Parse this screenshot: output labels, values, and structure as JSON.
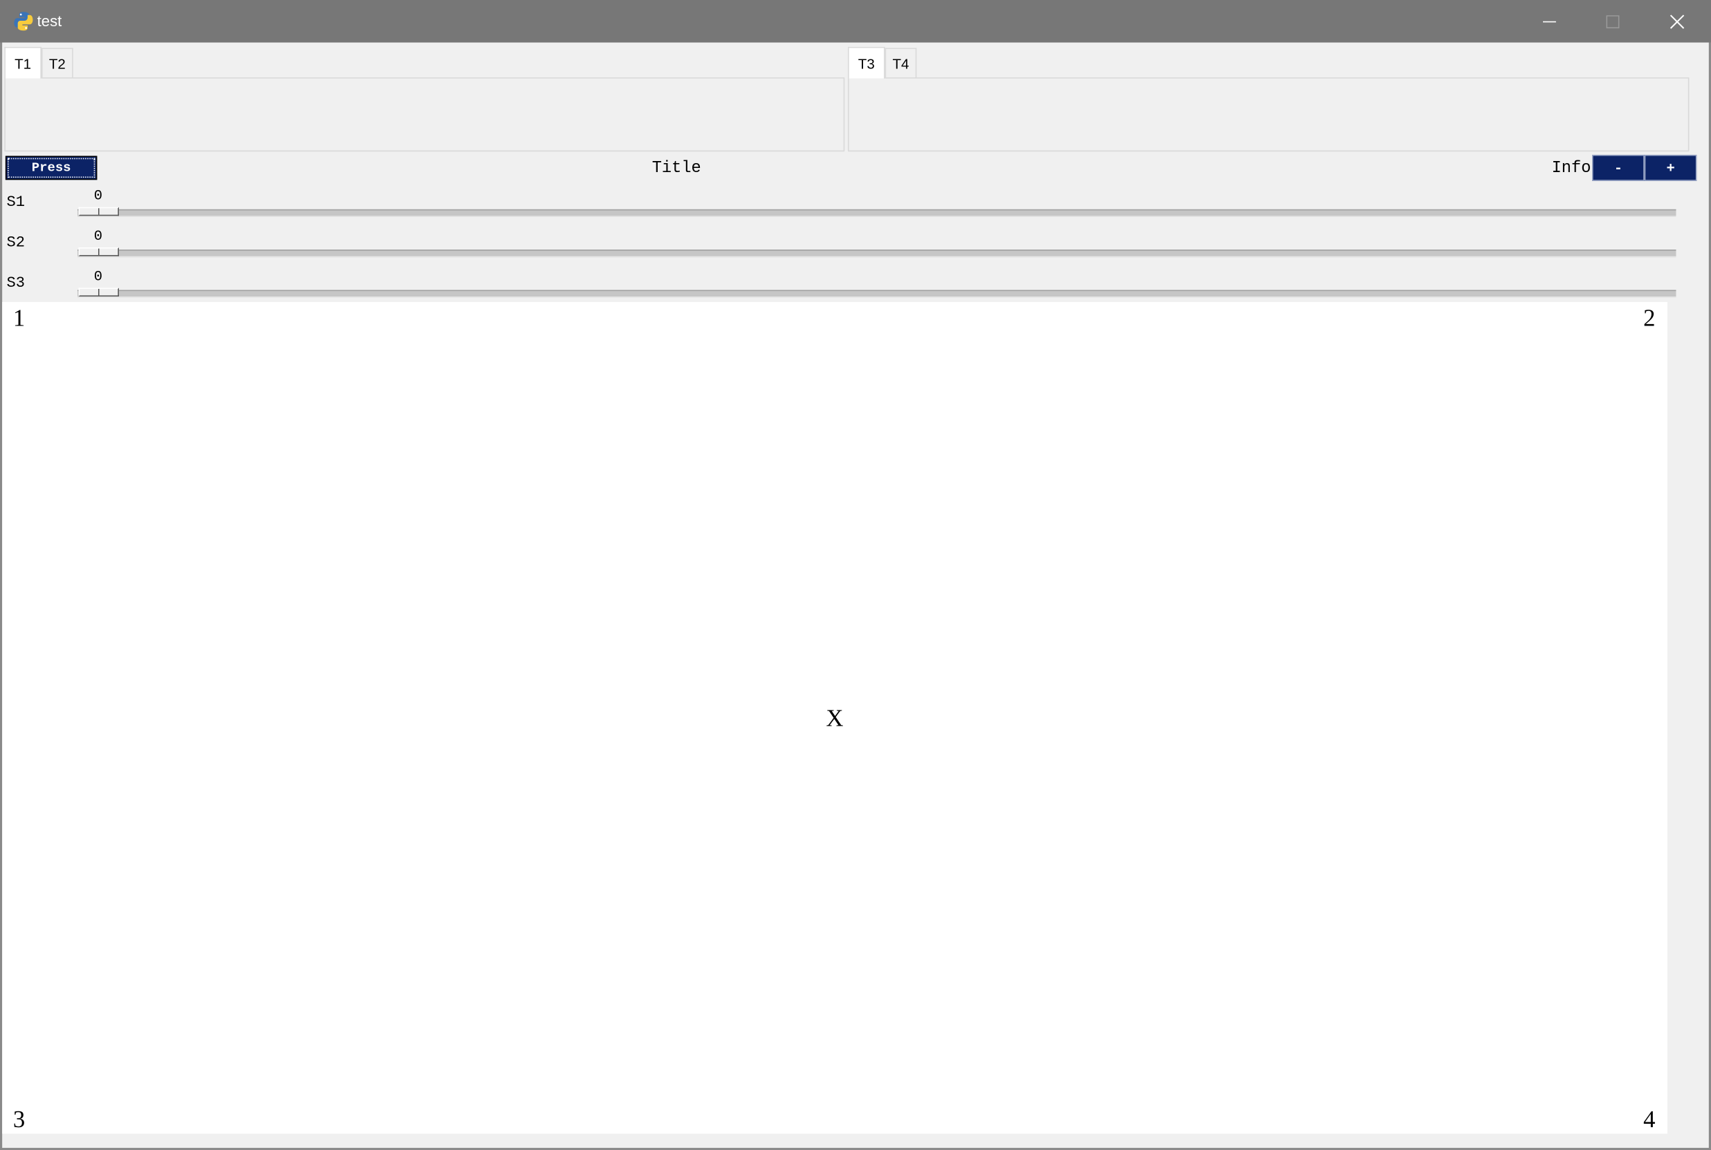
{
  "window": {
    "title": "test",
    "app_icon": "python-icon"
  },
  "tabs_left": [
    {
      "label": "T1",
      "selected": true
    },
    {
      "label": "T2",
      "selected": false
    }
  ],
  "tabs_right": [
    {
      "label": "T3",
      "selected": true
    },
    {
      "label": "T4",
      "selected": false
    }
  ],
  "toolbar": {
    "press_label": "Press",
    "title": "Title",
    "info": "Info",
    "minus_label": "-",
    "plus_label": "+"
  },
  "sliders": [
    {
      "label": "S1",
      "value": "0"
    },
    {
      "label": "S2",
      "value": "0"
    },
    {
      "label": "S3",
      "value": "0"
    }
  ],
  "canvas": {
    "corner_1": "1",
    "corner_2": "2",
    "corner_3": "3",
    "corner_4": "4",
    "center": "X"
  },
  "colors": {
    "titlebar": "#777777",
    "button_bg": "#0c2366",
    "background": "#f0f0f0",
    "canvas": "#ffffff"
  }
}
